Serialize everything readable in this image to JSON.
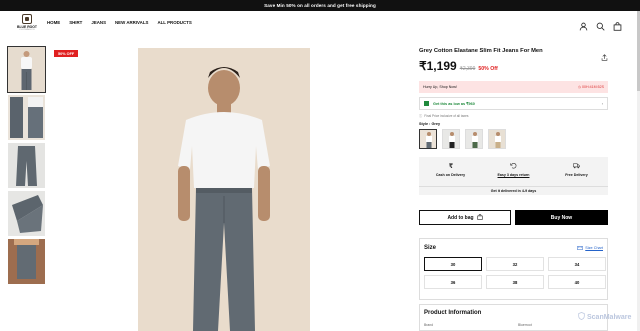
{
  "promo": {
    "text": "Save Min 50% on all orders and get free shipping"
  },
  "logo": {
    "name": "BLUE ROOT",
    "tagline": "CLOTHING CO"
  },
  "nav": {
    "items": [
      "HOME",
      "SHIRT",
      "JEANS",
      "NEW ARRIVALS",
      "ALL PRODUCTS"
    ]
  },
  "header_icons": [
    "user-icon",
    "search-icon",
    "shopping-bag-icon"
  ],
  "gallery": {
    "badge": "50% OFF",
    "thumbnail_count": 5
  },
  "product": {
    "title": "Grey Cotton Elastane Slim Fit Jeans For Men",
    "price": "₹1,199",
    "mrp": "₹2,399",
    "discount": "50% Off",
    "hurry_text": "Hurry Up, Shop Now!",
    "timer": "00H:41M:52S",
    "offer_text": "Get this as low as ₹960",
    "tax_note": "Final Price inclusive of all taxes",
    "style_label": "Style : Grey",
    "styles": [
      "White",
      "Black",
      "Green",
      "Beige"
    ]
  },
  "services": {
    "items": [
      {
        "label": "Cash on Delivery",
        "icon": "rupee-icon"
      },
      {
        "label": "Easy 3 days return",
        "icon": "return-icon"
      },
      {
        "label": "Free Delivery",
        "icon": "truck-icon"
      }
    ],
    "delivery_text": "Get it delivered in 4-9 days"
  },
  "actions": {
    "add_to_bag": "Add to bag",
    "buy_now": "Buy Now"
  },
  "sizes": {
    "label": "Size",
    "chart_label": "Size Chart",
    "options": [
      "30",
      "32",
      "34",
      "36",
      "38",
      "40"
    ],
    "selected": "30"
  },
  "product_info": {
    "heading": "Product Information",
    "row_label": "Brand",
    "row_value": "Bluerroot"
  },
  "watermark": "ScanMalware",
  "colors": {
    "accent": "#e02020",
    "offer_green": "#1f8a3c",
    "link_blue": "#2563c9"
  }
}
